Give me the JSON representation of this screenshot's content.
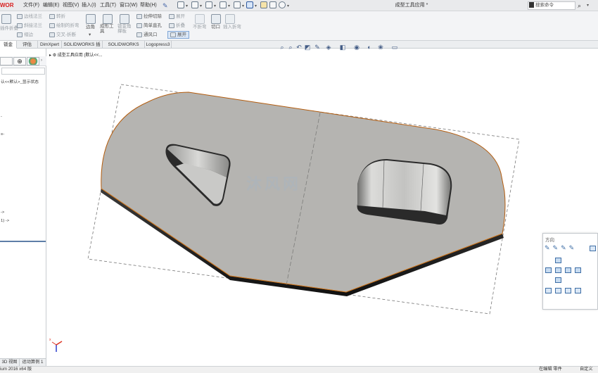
{
  "app": {
    "logo_text": "WORKS",
    "doc_title": "成型工具应用 *",
    "search_placeholder": "搜索命令"
  },
  "menu": [
    "文件(F)",
    "编辑(E)",
    "视图(V)",
    "插入(I)",
    "工具(T)",
    "窗口(W)",
    "帮助(H)"
  ],
  "ribbon": {
    "col1": [
      "边线法兰",
      "斜接法兰",
      "褶边"
    ],
    "col1_left": "插件折叠",
    "col2": [
      "转折",
      "绘制的折弯",
      "交叉-折断"
    ],
    "corner": "边角",
    "forming_tool": "成形工具",
    "sheet_metal_gusset": "钣金角撑板",
    "col3": [
      "拉伸切除",
      "简单直孔",
      "通风口"
    ],
    "col4": [
      "展开",
      "折叠",
      "不折弯"
    ],
    "unfold_active": "展开",
    "cut": "切口",
    "insert_bend": "插入折弯"
  },
  "tabs": [
    "钣金",
    "评估",
    "DimXpert",
    "SOLIDWORKS 插件",
    "SOLIDWORKS MBD",
    "Logopress3"
  ],
  "tree": {
    "breadcrumb": "成型工具应用 (默认<<...",
    "root": "认<<默认>_显示状态",
    "item_a": "->",
    "item_b": "1) ->"
  },
  "orientation": {
    "title": "方向"
  },
  "watermark": "沐风网",
  "bottom_tabs": [
    "3D 视图",
    "运动算例 1"
  ],
  "status": {
    "left": "ium 2016 x64 版",
    "editing": "在编辑 零件",
    "custom": "自定义"
  },
  "colors": {
    "part_face": "#b4b3b0",
    "part_edge_top": "#b45d0f",
    "part_side": "#1f1f1f",
    "accent": "#3e6ea6"
  }
}
